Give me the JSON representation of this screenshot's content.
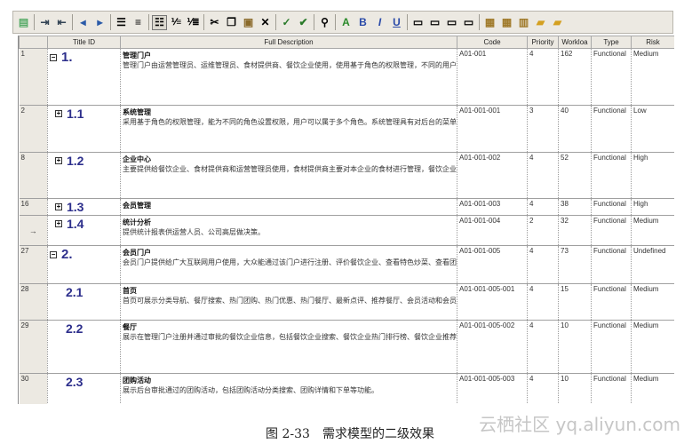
{
  "columns": {
    "title_id": "Title ID",
    "full_description": "Full Description",
    "code": "Code",
    "priority": "Priority",
    "workload": "Workloa",
    "type": "Type",
    "risk": "Risk"
  },
  "rows": [
    {
      "rowhdr": "1",
      "expander": "−",
      "title_id": "1.",
      "desc_title": "管理门户",
      "desc_body": "管理门户由运营管理员、运维管理员、食材提供商、餐饮企业使用，使用基于角色的权限管理，不同的用户能看到不同的菜单，并能根据登录角色显示不同的数据。主要包括系统管理、企业管理、会员管理和统计分析 4 个子需求。",
      "code": "A01-001",
      "priority": "4",
      "workload": "162",
      "type": "Functional",
      "risk": "Medium"
    },
    {
      "rowhdr": "2",
      "expander": "+",
      "title_id": "1.1",
      "desc_title": "系统管理",
      "desc_body": "采用基于角色的权限管理，能为不同的角色设置权限，用户可以属于多个角色。系统管理具有对后台的菜单管理、角色管理、用户管理、地区管理、数据字典维护、通知公告管理和日志管理功能。",
      "code": "A01-001-001",
      "priority": "3",
      "workload": "40",
      "type": "Functional",
      "risk": "Low"
    },
    {
      "rowhdr": "8",
      "expander": "+",
      "title_id": "1.2",
      "desc_title": "企业中心",
      "desc_body": "主要提供给餐饮企业、食材提供商和运营管理员使用，食材提供商主要对本企业的食材进行管理，餐饮企业对本企业的特色菜、团购活动、优惠券和促销活动进行管理。",
      "code": "A01-001-002",
      "priority": "4",
      "workload": "52",
      "type": "Functional",
      "risk": "High"
    },
    {
      "rowhdr": "16",
      "expander": "+",
      "title_id": "1.3",
      "desc_title": "会员管理",
      "desc_body": "",
      "code": "A01-001-003",
      "priority": "4",
      "workload": "38",
      "type": "Functional",
      "risk": "High"
    },
    {
      "rowhdr": "→",
      "expander": "+",
      "title_id": "1.4",
      "desc_title": "统计分析",
      "desc_body": "提供统计报表供运营人员、公司高层做决策。",
      "code": "A01-001-004",
      "priority": "2",
      "workload": "32",
      "type": "Functional",
      "risk": "Medium"
    },
    {
      "rowhdr": "27",
      "expander": "−",
      "title_id": "2.",
      "desc_title": "会员门户",
      "desc_body": "会员门户提供给广大互联网用户使用，大众能通过该门户进行注册、评价餐饮企业、查看特色炒菜、查看团购活动、查看优惠券、查看促销活动和团购下单等操作。",
      "code": "A01-001-005",
      "priority": "4",
      "workload": "73",
      "type": "Functional",
      "risk": "Undefined"
    },
    {
      "rowhdr": "28",
      "expander": "",
      "title_id": "2.1",
      "desc_title": "首页",
      "desc_body": "首页可展示分类导航、餐厅搜索、热门团购、热门优惠、热门餐厅、最新点评、推荐餐厅、会员活动和会员排行榜等信息。",
      "code": "A01-001-005-001",
      "priority": "4",
      "workload": "15",
      "type": "Functional",
      "risk": "Medium"
    },
    {
      "rowhdr": "29",
      "expander": "",
      "title_id": "2.2",
      "desc_title": "餐厅",
      "desc_body": "展示在管理门户注册并通过审批的餐饮企业信息，包括餐饮企业搜索、餐饮企业热门排行榜、餐饮企业推荐排行榜、餐饮企业详情、餐饮企业评价、相关图片和宣传视频等信息。",
      "code": "A01-001-005-002",
      "priority": "4",
      "workload": "10",
      "type": "Functional",
      "risk": "Medium"
    },
    {
      "rowhdr": "30",
      "expander": "",
      "title_id": "2.3",
      "desc_title": "团购活动",
      "desc_body": "展示后台审批通过的团购活动，包括团购活动分类搜索、团购详情和下单等功能。",
      "code": "A01-001-005-003",
      "priority": "4",
      "workload": "10",
      "type": "Functional",
      "risk": "Medium"
    }
  ],
  "caption": "图 2-33　需求模型的二级效果",
  "watermark": "云栖社区 yq.aliyun.com",
  "colors": {
    "title_number": "#2d2f8c",
    "header_bg": "#ece9e2"
  },
  "toolbar_icons": [
    "properties-icon",
    "sep",
    "indent-icon",
    "outdent-icon",
    "sep",
    "move-left-icon",
    "move-right-icon",
    "sep",
    "align-icon",
    "align-justify-icon",
    "sep",
    "list-view-icon",
    "numbering-icon",
    "renumber-icon",
    "sep",
    "cut-icon",
    "copy-icon",
    "paste-icon",
    "delete-icon",
    "sep",
    "spell-check-icon",
    "thesaurus-icon",
    "sep",
    "find-icon",
    "sep",
    "font-color-icon",
    "bold-icon",
    "italic-icon",
    "underline-icon",
    "sep",
    "align-left-icon",
    "align-center-icon",
    "align-right-icon",
    "align-full-icon",
    "sep",
    "image-icon",
    "table-icon",
    "chart-icon",
    "open-folder-icon",
    "new-folder-icon"
  ]
}
